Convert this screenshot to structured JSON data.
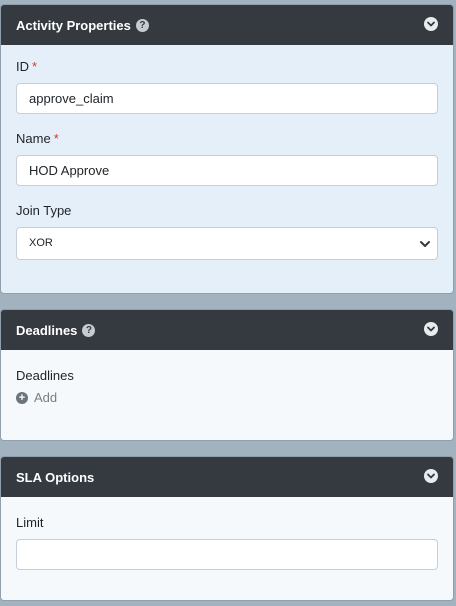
{
  "activity_properties": {
    "title": "Activity Properties",
    "help_icon": "?",
    "id_label": "ID",
    "id_required": "*",
    "id_value": "approve_claim",
    "name_label": "Name",
    "name_required": "*",
    "name_value": "HOD Approve",
    "join_type_label": "Join Type",
    "join_type_value": "XOR"
  },
  "deadlines": {
    "title": "Deadlines",
    "help_icon": "?",
    "section_label": "Deadlines",
    "add_label": "Add",
    "add_icon": "+"
  },
  "sla_options": {
    "title": "SLA Options",
    "limit_label": "Limit",
    "limit_value": ""
  },
  "icons": {
    "help": "question-circle-icon",
    "toggle": "chevron-down-circle-icon",
    "add": "plus-circle-icon"
  },
  "colors": {
    "header_bg": "#343a40",
    "body_blue": "#e5effa",
    "body_white": "#f5f9fc",
    "page_bg": "#a3b2bf",
    "required": "#d23b3b"
  }
}
